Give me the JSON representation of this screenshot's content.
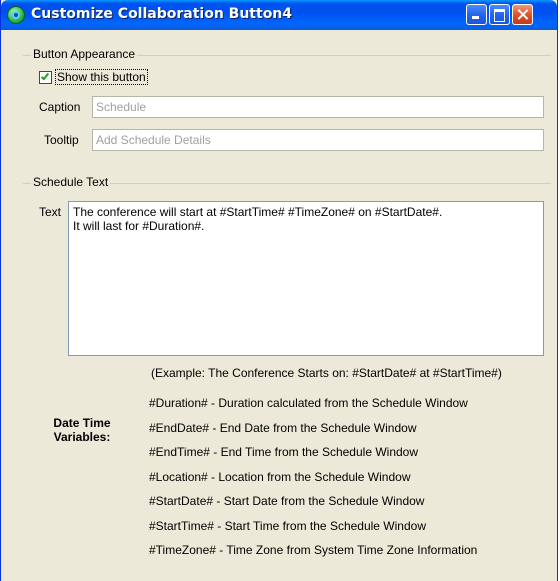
{
  "window": {
    "title": "Customize Collaboration Button4",
    "colors": {
      "titlebar": "#0054e3",
      "face": "#ece9d8",
      "close": "#e0532c"
    }
  },
  "appearance": {
    "legend": "Button Appearance",
    "show_button_label": "Show this button",
    "show_button_checked": true,
    "caption_label": "Caption",
    "caption_value": "Schedule",
    "tooltip_label": "Tooltip",
    "tooltip_value": "Add Schedule Details"
  },
  "schedule": {
    "legend": "Schedule Text",
    "text_label": "Text",
    "text_value": "The conference will start at #StartTime# #TimeZone# on #StartDate#.\nIt will last for #Duration#.",
    "example": "(Example: The Conference Starts on: #StartDate# at #StartTime#)",
    "variables_label_line1": "Date Time",
    "variables_label_line2": "Variables:",
    "variables": [
      "#Duration# - Duration calculated from the Schedule Window",
      "#EndDate# - End Date from the Schedule Window",
      "#EndTime# - End Time from the Schedule Window",
      "#Location# - Location from the Schedule Window",
      "#StartDate# - Start Date from the Schedule Window",
      "#StartTime# - Start Time from the Schedule Window",
      "#TimeZone# - Time Zone from System Time Zone Information"
    ]
  },
  "icons": {
    "app": "collaboration-app-icon",
    "minimize": "minimize-icon",
    "maximize": "maximize-icon",
    "close": "close-icon",
    "check": "checkmark-icon"
  }
}
